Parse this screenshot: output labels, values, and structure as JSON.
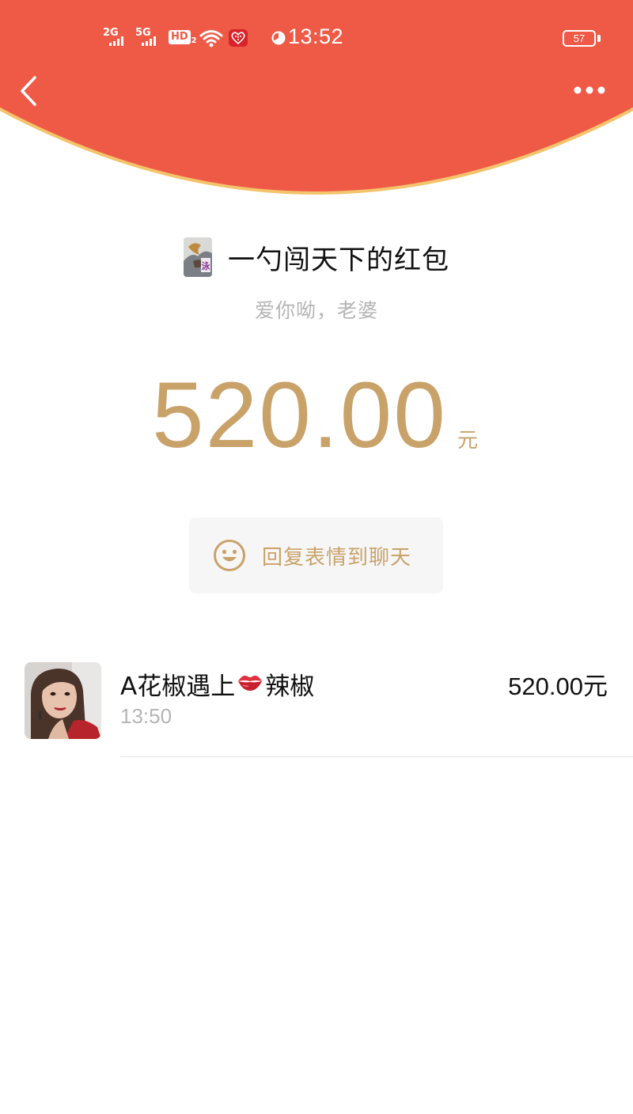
{
  "status_bar": {
    "signal_1": "2G",
    "signal_2": "5G",
    "hd_label": "HD",
    "hd_sub": "2",
    "time": "13:52",
    "battery": "57"
  },
  "nav": {
    "back_icon": "chevron-left-icon",
    "more_icon": "more-dots-icon"
  },
  "packet": {
    "title": "一勺闯天下的红包",
    "blessing": "爱你呦，老婆",
    "amount": "520.00",
    "unit": "元"
  },
  "reply": {
    "label": "回复表情到聊天",
    "icon": "smiley-icon"
  },
  "records": [
    {
      "name_prefix": "A花椒遇上",
      "name_suffix": "辣椒",
      "emoji": "lips-icon",
      "time": "13:50",
      "amount": "520.00元"
    }
  ],
  "colors": {
    "header_red": "#ef5a47",
    "gold": "#c9a26a",
    "header_rim": "#f3c46b"
  }
}
